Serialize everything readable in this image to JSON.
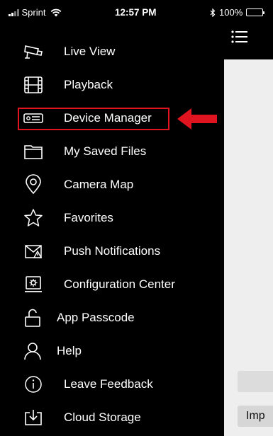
{
  "status_bar": {
    "carrier": "Sprint",
    "time": "12:57 PM",
    "battery": "100%",
    "battery_level": 1.0
  },
  "menu": {
    "items": [
      {
        "label": "Live View",
        "icon": "cctv-camera-icon"
      },
      {
        "label": "Playback",
        "icon": "film-strip-icon"
      },
      {
        "label": "Device Manager",
        "icon": "device-card-icon"
      },
      {
        "label": "My Saved Files",
        "icon": "folder-icon"
      },
      {
        "label": "Camera Map",
        "icon": "map-pin-icon"
      },
      {
        "label": "Favorites",
        "icon": "star-icon"
      },
      {
        "label": "Push Notifications",
        "icon": "alert-envelope-icon"
      },
      {
        "label": "Configuration Center",
        "icon": "monitor-gear-icon"
      },
      {
        "label": "App Passcode",
        "icon": "unlock-icon"
      },
      {
        "label": "Help",
        "icon": "person-icon"
      },
      {
        "label": "Leave Feedback",
        "icon": "info-icon"
      },
      {
        "label": "Cloud Storage",
        "icon": "download-tray-icon"
      }
    ]
  },
  "main": {
    "bottom_button_label": "Imp"
  },
  "colors": {
    "highlight": "#e0141e",
    "drawer_bg": "#000000",
    "content_bg": "#eeeeee"
  }
}
